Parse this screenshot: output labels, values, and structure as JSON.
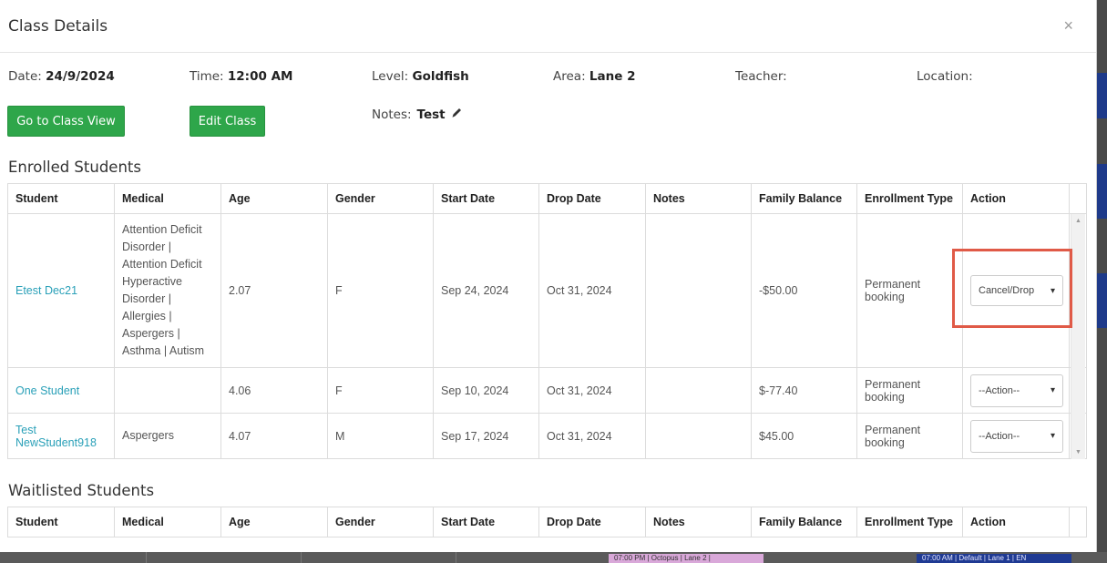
{
  "modal": {
    "title": "Class Details",
    "close": "×"
  },
  "info": {
    "date_label": "Date:",
    "date": "24/9/2024",
    "time_label": "Time:",
    "time": "12:00 AM",
    "level_label": "Level:",
    "level": "Goldfish",
    "area_label": "Area:",
    "area": "Lane 2",
    "teacher_label": "Teacher:",
    "location_label": "Location:",
    "notes_label": "Notes:",
    "notes": "Test"
  },
  "buttons": {
    "class_view": "Go to Class View",
    "edit_class": "Edit Class"
  },
  "enrolled": {
    "title": "Enrolled Students",
    "columns": [
      "Student",
      "Medical",
      "Age",
      "Gender",
      "Start Date",
      "Drop Date",
      "Notes",
      "Family Balance",
      "Enrollment Type",
      "Action"
    ],
    "rows": [
      {
        "student": "Etest Dec21",
        "medical": "Attention Deficit Disorder | Attention Deficit Hyperactive Disorder | Allergies | Aspergers | Asthma | Autism",
        "age": "2.07",
        "gender": "F",
        "start": "Sep 24, 2024",
        "drop": "Oct 31, 2024",
        "notes": "",
        "balance": "-$50.00",
        "type": "Permanent booking",
        "action": "Cancel/Drop"
      },
      {
        "student": "One Student",
        "medical": "",
        "age": "4.06",
        "gender": "F",
        "start": "Sep 10, 2024",
        "drop": "Oct 31, 2024",
        "notes": "",
        "balance": "$-77.40",
        "type": "Permanent booking",
        "action": "--Action--"
      },
      {
        "student": "Test NewStudent918",
        "medical": "Aspergers",
        "age": "4.07",
        "gender": "M",
        "start": "Sep 17, 2024",
        "drop": "Oct 31, 2024",
        "notes": "",
        "balance": "$45.00",
        "type": "Permanent booking",
        "action": "--Action--"
      }
    ]
  },
  "waitlisted": {
    "title": "Waitlisted Students",
    "columns": [
      "Student",
      "Medical",
      "Age",
      "Gender",
      "Start Date",
      "Drop Date",
      "Notes",
      "Family Balance",
      "Enrollment Type",
      "Action"
    ]
  },
  "background": {
    "chip_pink": "07:00 PM | Octopus | Lane 2 |",
    "chip_navy": "07:00 AM | Default | Lane 1 | EN"
  },
  "colors": {
    "primary_button": "#2ea64a",
    "link": "#2aa0b8",
    "highlight": "#e05a47"
  }
}
